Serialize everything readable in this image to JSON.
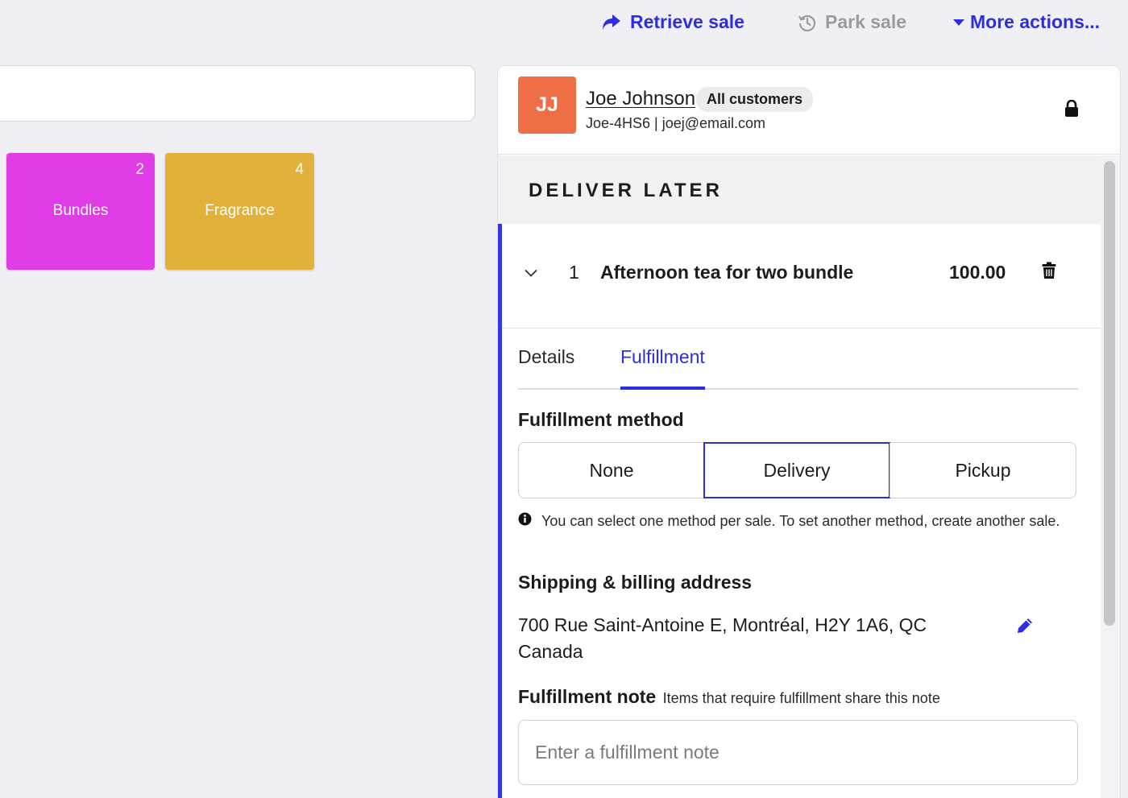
{
  "top_actions": {
    "retrieve": "Retrieve sale",
    "park": "Park sale",
    "more": "More actions..."
  },
  "categories": [
    {
      "label": "Bundles",
      "count": "2",
      "color": "#e03de9"
    },
    {
      "label": "Fragrance",
      "count": "4",
      "color": "#e2b13b"
    }
  ],
  "customer": {
    "initials": "JJ",
    "name": "Joe Johnson",
    "group": "All customers",
    "meta": "Joe-4HS6 | joej@email.com"
  },
  "section": {
    "title": "DELIVER LATER"
  },
  "line_item": {
    "quantity": "1",
    "name": "Afternoon tea for two bundle",
    "price": "100.00"
  },
  "tabs": {
    "details": "Details",
    "fulfillment": "Fulfillment",
    "active": "Fulfillment"
  },
  "fulfillment": {
    "method_title": "Fulfillment method",
    "options": [
      "None",
      "Delivery",
      "Pickup"
    ],
    "selected": "Delivery",
    "info": "You can select one method per sale. To set another method, create another sale.",
    "address_title": "Shipping & billing address",
    "address_line1": "700 Rue Saint-Antoine E, Montréal, H2Y 1A6, QC",
    "address_line2": "Canada",
    "note_title": "Fulfillment note",
    "note_hint": "Items that require fulfillment share this note",
    "note_placeholder": "Enter a fulfillment note"
  },
  "colors": {
    "accent": "#2c2ee0",
    "avatar": "#ee6e46"
  }
}
